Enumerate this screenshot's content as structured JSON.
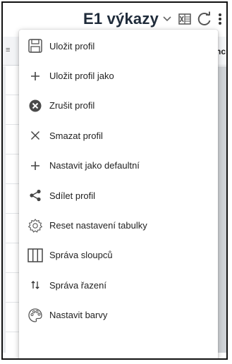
{
  "toolbar": {
    "title": "E1 výkazy",
    "icons": [
      "chevron-down-icon",
      "excel-icon",
      "refresh-icon",
      "more-vert-icon"
    ]
  },
  "background_table": {
    "left_fragment": "≡",
    "right_fragment": "nc"
  },
  "menu": {
    "items": [
      {
        "label": "Uložit profil",
        "icon": "save-icon"
      },
      {
        "label": "Uložit profil jako",
        "icon": "plus-icon"
      },
      {
        "label": "Zrušit profil",
        "icon": "cancel-circle-icon"
      },
      {
        "label": "Smazat profil",
        "icon": "close-icon"
      },
      {
        "label": "Nastavit jako defaultní",
        "icon": "plus-icon"
      },
      {
        "label": "Sdílet profil",
        "icon": "share-icon"
      },
      {
        "label": "Reset nastavení tabulky",
        "icon": "reset-settings-icon"
      },
      {
        "label": "Správa sloupců",
        "icon": "columns-icon"
      },
      {
        "label": "Správa řazení",
        "icon": "sort-icon"
      },
      {
        "label": "Nastavit barvy",
        "icon": "palette-icon"
      }
    ]
  },
  "colors": {
    "title": "#1f2b3a",
    "icon": "#555555",
    "menu_text": "#222222",
    "frame": "#111111"
  }
}
